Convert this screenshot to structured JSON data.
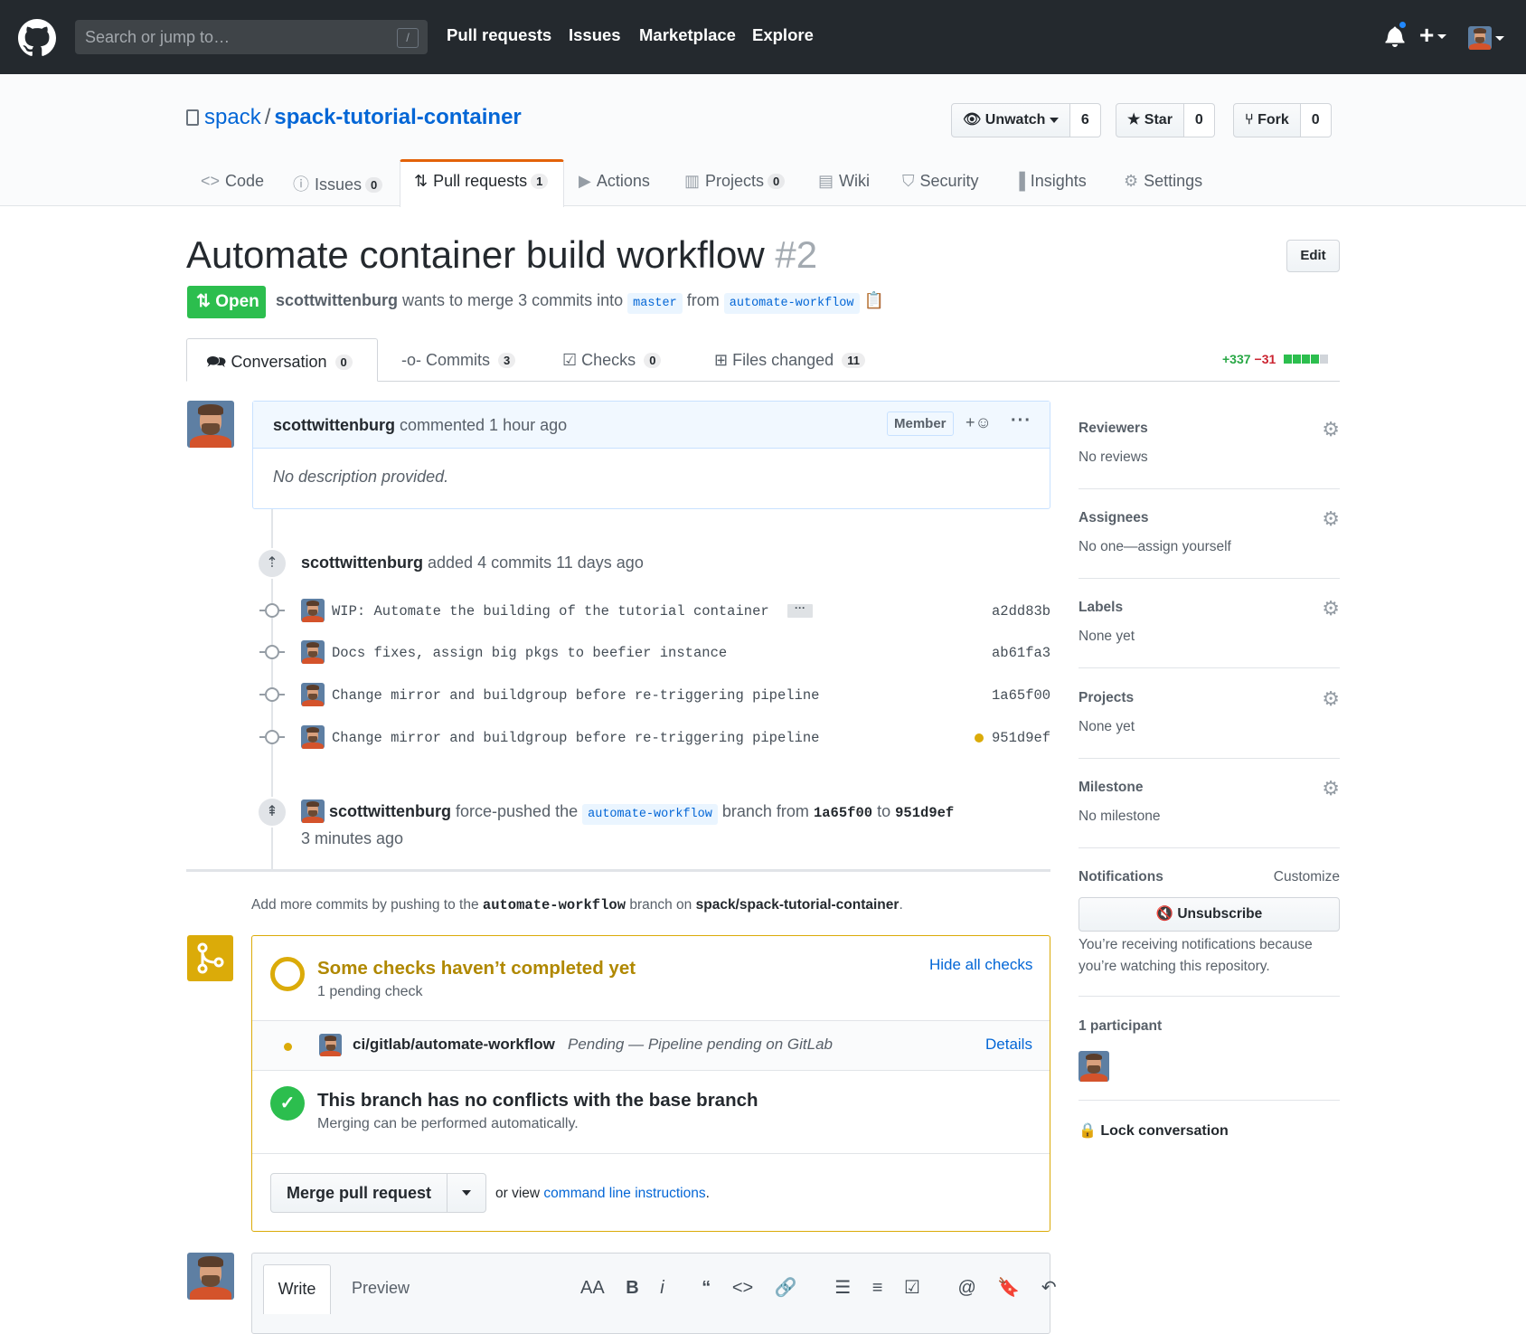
{
  "header": {
    "search_placeholder": "Search or jump to…",
    "search_key": "/",
    "nav": [
      "Pull requests",
      "Issues",
      "Marketplace",
      "Explore"
    ],
    "plus": "+"
  },
  "repo": {
    "owner": "spack",
    "separator": "/",
    "name": "spack-tutorial-container",
    "unwatch_label": "Unwatch",
    "watch_count": "6",
    "star_label": "Star",
    "star_count": "0",
    "fork_label": "Fork",
    "fork_count": "0",
    "tabs": [
      {
        "label": "Code",
        "icon": "<>"
      },
      {
        "label": "Issues",
        "count": "0",
        "icon": "!"
      },
      {
        "label": "Pull requests",
        "count": "1",
        "icon": "pr"
      },
      {
        "label": "Actions",
        "icon": "play"
      },
      {
        "label": "Projects",
        "count": "0",
        "icon": "board"
      },
      {
        "label": "Wiki",
        "icon": "book"
      },
      {
        "label": "Security",
        "icon": "shield"
      },
      {
        "label": "Insights",
        "icon": "graph"
      },
      {
        "label": "Settings",
        "icon": "gear"
      }
    ]
  },
  "pr": {
    "title": "Automate container build workflow",
    "number": "#2",
    "edit_label": "Edit",
    "state": "Open",
    "author": "scottwittenburg",
    "meta_mid": "wants to merge 3 commits into",
    "base": "master",
    "from_word": "from",
    "head": "automate-workflow",
    "tabs": [
      {
        "label": "Conversation",
        "count": "0"
      },
      {
        "label": "Commits",
        "count": "3"
      },
      {
        "label": "Checks",
        "count": "0"
      },
      {
        "label": "Files changed",
        "count": "11"
      }
    ],
    "additions": "+337",
    "deletions": "−31"
  },
  "comment": {
    "author": "scottwittenburg",
    "action": "commented 1 hour ago",
    "badge": "Member",
    "react": "+☺",
    "kebab": "···",
    "body": "No description provided."
  },
  "commits_event": {
    "author": "scottwittenburg",
    "text": "added 4 commits 11 days ago",
    "commits": [
      {
        "message": "WIP: Automate the building of the tutorial container",
        "sha": "a2dd83b"
      },
      {
        "message": "Docs fixes, assign big pkgs to beefier instance",
        "sha": "ab61fa3"
      },
      {
        "message": "Change mirror and buildgroup before re-triggering pipeline",
        "sha": "1a65f00"
      },
      {
        "message": "Change mirror and buildgroup before re-triggering pipeline",
        "sha": "951d9ef"
      }
    ],
    "ellipsis": "···"
  },
  "force_push": {
    "author": "scottwittenburg",
    "text1": "force-pushed the",
    "branch": "automate-workflow",
    "text2": "branch from",
    "from_sha": "1a65f00",
    "to_word": "to",
    "to_sha": "951d9ef",
    "time": "3 minutes ago"
  },
  "push_hint": {
    "pre": "Add more commits by pushing to the",
    "branch": "automate-workflow",
    "mid": "branch on",
    "repo": "spack/spack-tutorial-container",
    "end": "."
  },
  "merge": {
    "checks_title": "Some checks haven’t completed yet",
    "checks_sub": "1 pending check",
    "hide_checks": "Hide all checks",
    "check_name": "ci/gitlab/automate-workflow",
    "check_status": "Pending — Pipeline pending on GitLab",
    "check_details": "Details",
    "ok_title": "This branch has no conflicts with the base branch",
    "ok_sub": "Merging can be performed automatically.",
    "merge_button": "Merge pull request",
    "alt_pre": "or view",
    "alt_link": "command line instructions",
    "alt_end": ".",
    "check_mark": "✓"
  },
  "write": {
    "write_tab": "Write",
    "preview_tab": "Preview",
    "tools": [
      "AA",
      "B",
      "i",
      "“",
      "<>",
      "🔗",
      "☰",
      "≡",
      "☑",
      "@",
      "🔖",
      "↶"
    ]
  },
  "sidebar": {
    "reviewers": {
      "title": "Reviewers",
      "value": "No reviews"
    },
    "assignees": {
      "title": "Assignees",
      "value": "No one—assign yourself"
    },
    "labels": {
      "title": "Labels",
      "value": "None yet"
    },
    "projects": {
      "title": "Projects",
      "value": "None yet"
    },
    "milestone": {
      "title": "Milestone",
      "value": "No milestone"
    },
    "notifications": {
      "title": "Notifications",
      "customize": "Customize",
      "unsubscribe": "Unsubscribe",
      "reason": "You’re receiving notifications because you’re watching this repository."
    },
    "participants": {
      "title": "1 participant"
    },
    "lock": "Lock conversation"
  },
  "colors": {
    "header_bg": "#24292e",
    "link": "#0366d6",
    "open_green": "#2cbe4e",
    "pending_yellow": "#dbab09",
    "pr_tab_accent": "#e36209"
  }
}
